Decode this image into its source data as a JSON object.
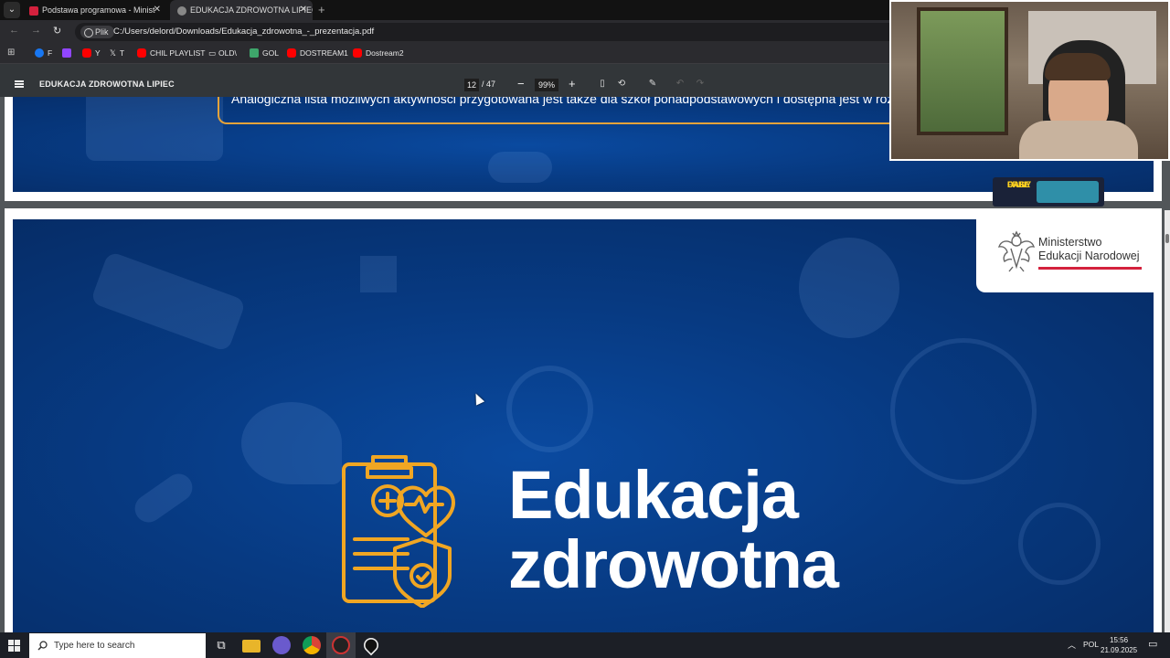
{
  "browser": {
    "tabs": [
      {
        "title": "Podstawa programowa - Minist",
        "active": false
      },
      {
        "title": "EDUKACJA ZDROWOTNA LIPIEC",
        "active": true
      }
    ],
    "new_tab": "+",
    "address": {
      "site_info": "Plik",
      "url": "C:/Users/delord/Downloads/Edukacja_zdrowotna_-_prezentacja.pdf"
    },
    "bookmarks": [
      {
        "label": "F",
        "color": "#1877f2"
      },
      {
        "label": "",
        "color": "#9146ff"
      },
      {
        "label": "Y",
        "color": "#ff0000"
      },
      {
        "label": "T",
        "color": "#e6e6e6"
      },
      {
        "label": "CHIL PLAYLIST",
        "color": "#ff0000"
      },
      {
        "label": "OLD\\",
        "color": "#cfcfcf"
      },
      {
        "label": "GOL",
        "color": "#3ea66b"
      },
      {
        "label": "DOSTREAM1",
        "color": "#ff0000"
      },
      {
        "label": "Dostream2",
        "color": "#ff0000"
      }
    ]
  },
  "pdf": {
    "title": "EDUKACJA ZDROWOTNA LIPIEC",
    "page_current": "12",
    "page_total": "/ 47",
    "zoom": "99%",
    "zoom_out": "−",
    "zoom_in": "+"
  },
  "slides": {
    "top_callout": "Analogiczna lista możliwych aktywności przygotowana jest także dla szkół ponadpodstawowych i dostępna jest w rozpo",
    "ministry": {
      "line1": "Ministerstwo",
      "line2": "Edukacji Narodowej"
    },
    "title_line1": "Edukacja",
    "title_line2": "zdrowotna"
  },
  "overlay": {
    "promo_line1": "FREE",
    "promo_line2": "DAILY",
    "promo_line3": "CASE"
  },
  "taskbar": {
    "search_placeholder": "Type here to search",
    "lang": "POL",
    "time": "15:56",
    "date": "21.09.2025"
  },
  "colors": {
    "slide_blue": "#073a82",
    "accent_orange": "#e5a33a",
    "ministry_red": "#d4213d"
  }
}
